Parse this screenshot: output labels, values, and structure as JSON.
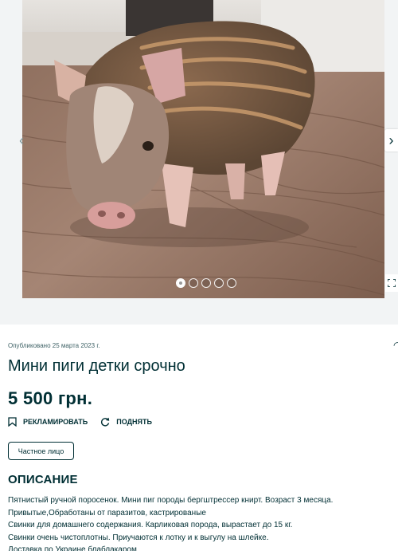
{
  "gallery": {
    "photo_alt": "Мини пиги детки срочно",
    "dot_count": 5,
    "active_dot": 1,
    "prev_icon": "chevron-left-icon",
    "next_icon": "chevron-right-icon",
    "expand_icon": "expand-icon"
  },
  "listing": {
    "published": "Опубликовано 25 марта 2023 г.",
    "title": "Мини пиги детки срочно",
    "price": "5 500 грн.",
    "actions": {
      "promote_label": "РЕКЛАМИРОВАТЬ",
      "raise_label": "ПОДНЯТЬ"
    },
    "seller_type": "Частное лицо",
    "description_heading": "ОПИСАНИЕ",
    "description_lines": [
      "Пятнистый ручной поросенок. Мини пиг породы бергштрессер книрт. Возраст 3 месяца.",
      "Привытые,Обработаны от паразитов, кастрированые",
      "Свинки для домашнего содержания. Карликовая порода, вырастает до 15 кг.",
      "Свинки очень чистоплотны. Приучаются к лотку и к выгулу на шлейке.",
      "Доставка по Украине блаблакаром"
    ]
  },
  "colors": {
    "text": "#002f34",
    "muted": "#406367",
    "background": "#f2f4f5"
  }
}
